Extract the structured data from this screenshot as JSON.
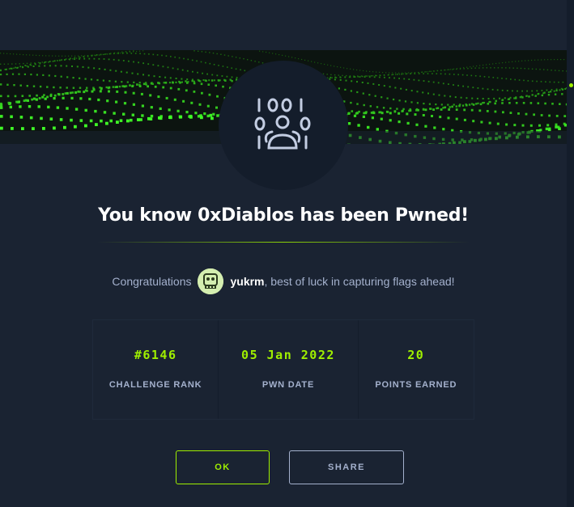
{
  "banner": {
    "icon": "binary-users-icon",
    "background_pattern": "green-wave-grid"
  },
  "header": {
    "title": "You know 0xDiablos has been Pwned!"
  },
  "message": {
    "prefix": "Congratulations",
    "username": "yukrm",
    "suffix": ", best of luck in capturing flags ahead!"
  },
  "stats": [
    {
      "value": "#6146",
      "label": "CHALLENGE RANK"
    },
    {
      "value": "05 Jan 2022",
      "label": "PWN DATE"
    },
    {
      "value": "20",
      "label": "POINTS EARNED"
    }
  ],
  "actions": {
    "ok_label": "OK",
    "share_label": "SHARE"
  },
  "colors": {
    "background": "#1a2332",
    "dark_panel": "#141d2b",
    "accent": "#9fef00",
    "muted_text": "#a4b1cd",
    "title_text": "#ffffff"
  }
}
